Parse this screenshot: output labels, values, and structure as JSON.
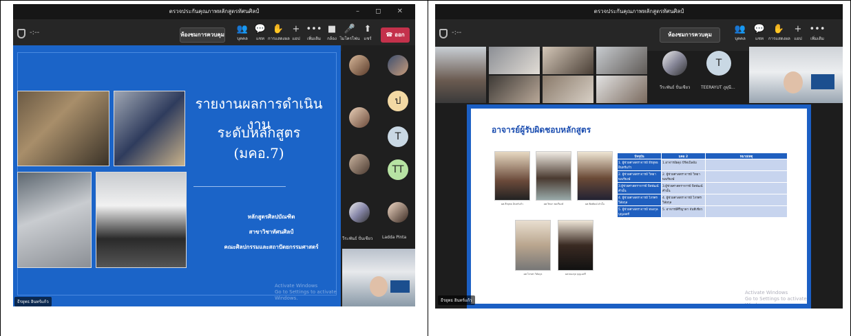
{
  "left": {
    "window_title": "ตรวจประกันคุณภาพหลักสูตรทัศนศิลป์",
    "window_controls": "– ◻ ✕",
    "room_button": "ห้องชมการควบคุม",
    "tools": [
      {
        "icon": "people-icon",
        "glyph": "👥",
        "label": "บุคคล"
      },
      {
        "icon": "chat-icon",
        "glyph": "💬",
        "label": "แชท"
      },
      {
        "icon": "reactions-icon",
        "glyph": "✋",
        "label": "การแสดงผล"
      },
      {
        "icon": "plus-icon",
        "glyph": "+",
        "label": "แอป"
      },
      {
        "icon": "more-icon",
        "glyph": "•••",
        "label": "เพิ่มเติม"
      },
      {
        "icon": "camera-icon",
        "glyph": "■",
        "label": "กล้อง"
      },
      {
        "icon": "mic-icon",
        "glyph": "🎤",
        "label": "ไมโครโฟน"
      },
      {
        "icon": "share-icon",
        "glyph": "⬆",
        "label": "แชร์"
      }
    ],
    "leave_label": "ออก",
    "slide": {
      "title_line1": "รายงานผลการดำเนินงาน",
      "title_line2": "ระดับหลักสูตร (มคอ.7)",
      "sub1": "หลักสูตรศิลปบัณฑิต",
      "sub2": "สาขาวิชาทัศนศิลป์",
      "sub3": "คณะศิลปกรรมและสถาปัตยกรรมศาสตร์",
      "watermark1": "Activate Windows",
      "watermark2": "Go to Settings to activate Windows."
    },
    "presenter_name": "ธีรยุทธ อินทร์แก้ว",
    "participants": [
      {
        "initial": "ป",
        "color": "#f3d9a4"
      },
      {
        "initial": "T",
        "color": "#c9d8e4"
      },
      {
        "initial": "TT",
        "color": "#b7e3a3"
      }
    ],
    "name_a": "วีระพันธ์ ปั่นเชียว",
    "name_b": "Ladda Pinta"
  },
  "right": {
    "window_title": "ตรวจประกันคุณภาพหลักสูตรทัศนศิลป์",
    "room_button": "ห้องชมการควบคุม",
    "tools": [
      {
        "icon": "people-icon",
        "glyph": "👥",
        "label": "บุคคล"
      },
      {
        "icon": "chat-icon",
        "glyph": "💬",
        "label": "แชท"
      },
      {
        "icon": "reactions-icon",
        "glyph": "✋",
        "label": "การแสดงผล"
      },
      {
        "icon": "plus-icon",
        "glyph": "+",
        "label": "แอป"
      },
      {
        "icon": "more-icon",
        "glyph": "•••",
        "label": "เพิ่มเติม"
      }
    ],
    "participant_initial": "T",
    "participant_a_name": "วีระพันธ์ ปั่นเชียว",
    "participant_b_name": "TEERAYUT ภูผุ่นี...",
    "slide_title": "อาจารย์ผู้รับผิดชอบหลักสูตร",
    "table_headers": [
      "ปัจจุบัน",
      "มคอ 2",
      "หมายเหตุ"
    ],
    "table_rows": [
      [
        "1. ผู้ช่วยศาสตราจารย์ ธีรยุทธ อินทร์แก้ว",
        "1.อาจารย์ผดุง บีร์ดเบิลอ้ม",
        ""
      ],
      [
        "2. ผู้ช่วยศาสตราจารย์ วิทยา พลเรียงษ์",
        "2. ผู้ช่วยศาสตราจารย์ วิทยา พลเรียงษ์",
        ""
      ],
      [
        "3.ผู้ช่วยศาสตราจารย์ พิลพัฒน์ คำมั้น",
        "3.ผู้ช่วยศาสตราจารย์ พิลพัฒน์ คำมั้น",
        ""
      ],
      [
        "4. ผู้ช่วยศาสตราจารย์ ไกรศร วิลัยกุล",
        "4. ผู้ช่วยศาสตราจารย์ ไกรศร วิลัยกุล",
        ""
      ],
      [
        "5. ผู้ช่วยศาสตราจารย์ ทองกุล บุญเอสกี",
        "5. อาจารย์ศิริญาดา จันทีเชียว",
        ""
      ]
    ],
    "watermark1": "Activate Windows",
    "watermark2": "Go to Settings to activate Windows.",
    "presenter_name": "ธีรยุทธ อินทร์แก้ว"
  }
}
